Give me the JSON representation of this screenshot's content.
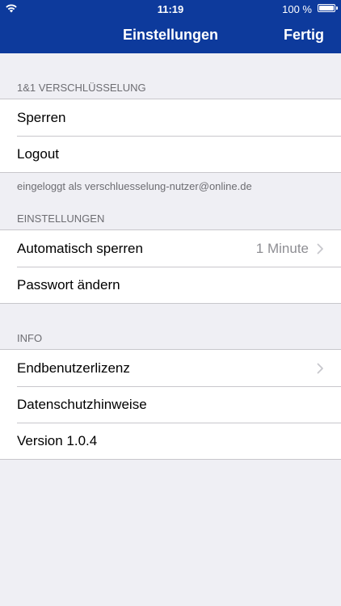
{
  "statusbar": {
    "time": "11:19",
    "battery": "100 %"
  },
  "nav": {
    "title": "Einstellungen",
    "done_label": "Fertig",
    "bar_color": "#0d3a9c"
  },
  "sections": {
    "encryption": {
      "header": "1&1 VERSCHLÜSSELUNG",
      "rows": [
        {
          "label": "Sperren"
        },
        {
          "label": "Logout"
        }
      ],
      "footer": "eingeloggt als verschluesselung-nutzer@online.de"
    },
    "settings": {
      "header": "EINSTELLUNGEN",
      "rows": [
        {
          "label": "Automatisch sperren",
          "value": "1 Minute"
        },
        {
          "label": "Passwort ändern"
        }
      ]
    },
    "info": {
      "header": "INFO",
      "rows": [
        {
          "label": "Endbenutzerlizenz"
        },
        {
          "label": "Datenschutzhinweise"
        },
        {
          "label": "Version 1.0.4"
        }
      ]
    }
  },
  "icons": {
    "wifi": "wifi-icon",
    "battery": "battery-icon",
    "disclosure": "chevron-right-icon"
  }
}
